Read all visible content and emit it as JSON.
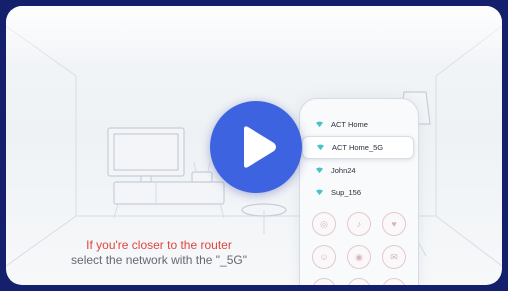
{
  "video": {
    "play_icon": "play-icon",
    "accent_color": "#3e63e0"
  },
  "phone": {
    "networks": [
      {
        "name": "ACT Home",
        "selected": false
      },
      {
        "name": "ACT Home_5G",
        "selected": true
      },
      {
        "name": "John24",
        "selected": false
      },
      {
        "name": "Sup_156",
        "selected": false
      }
    ]
  },
  "caption": {
    "line1": "If you're closer to the router",
    "line2": "select the network with the \"_5G\""
  },
  "colors": {
    "caption_highlight": "#e0463f",
    "caption_body": "#646a73",
    "frame_background": "#14206b"
  }
}
